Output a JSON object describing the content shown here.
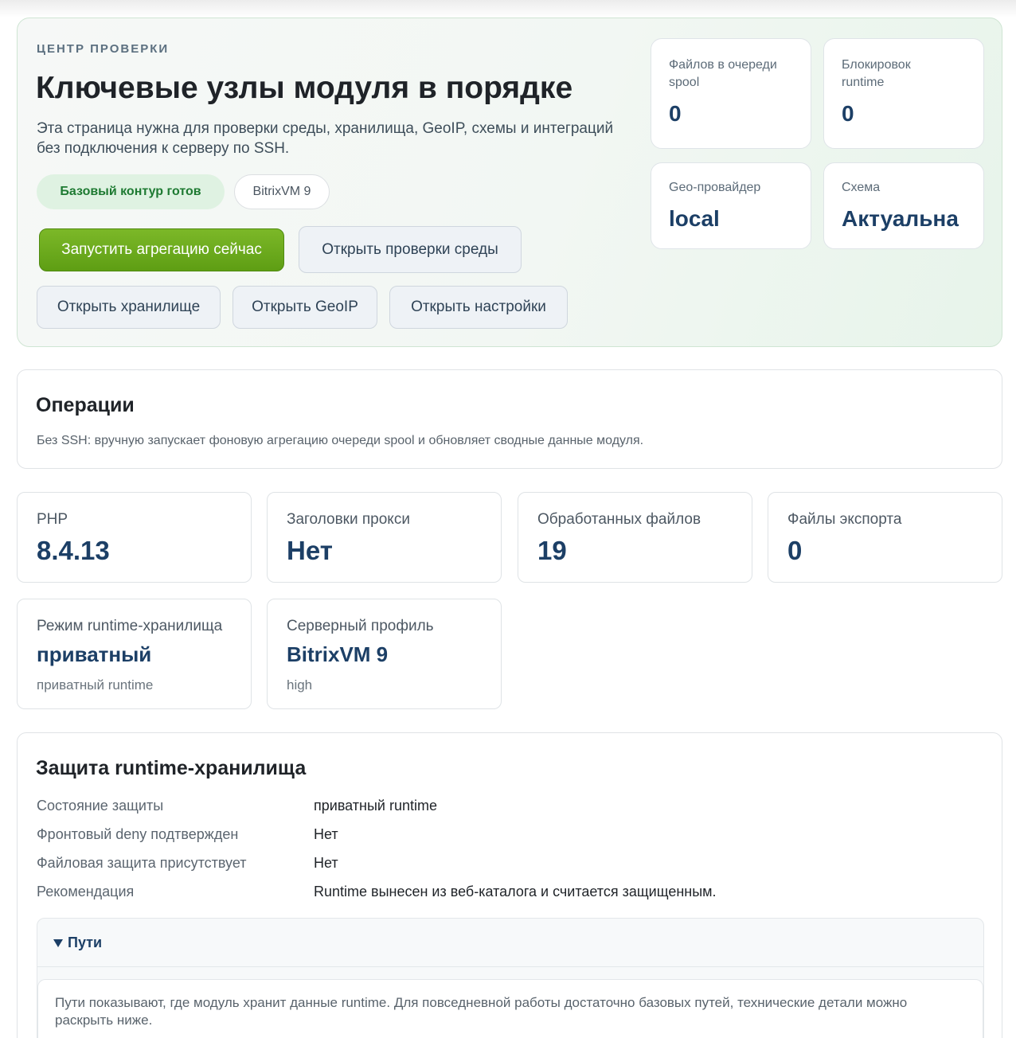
{
  "hero": {
    "eyebrow": "ЦЕНТР ПРОВЕРКИ",
    "title": "Ключевые узлы модуля в порядке",
    "description": "Эта страница нужна для проверки среды, хранилища, GeoIP, схемы и интеграций без подключения к серверу по SSH.",
    "status_pill": "Базовый контур готов",
    "profile_pill": "BitrixVM 9",
    "buttons": {
      "run_aggregation": "Запустить агрегацию сейчас",
      "open_env_checks": "Открыть проверки среды",
      "open_storage": "Открыть хранилище",
      "open_geoip": "Открыть GeoIP",
      "open_settings": "Открыть настройки"
    },
    "stats": [
      {
        "label": "Файлов в очереди spool",
        "value": "0"
      },
      {
        "label": "Блокировок runtime",
        "value": "0"
      },
      {
        "label": "Geo-провайдер",
        "value": "local"
      },
      {
        "label": "Схема",
        "value": "Актуальна"
      }
    ]
  },
  "operations": {
    "title": "Операции",
    "description": "Без SSH: вручную запускает фоновую агрегацию очереди spool и обновляет сводные данные модуля."
  },
  "metrics": [
    {
      "label": "PHP",
      "value": "8.4.13"
    },
    {
      "label": "Заголовки прокси",
      "value": "Нет"
    },
    {
      "label": "Обработанных файлов",
      "value": "19"
    },
    {
      "label": "Файлы экспорта",
      "value": "0"
    },
    {
      "label": "Режим runtime-хранилища",
      "value": "приватный",
      "sub": "приватный runtime"
    },
    {
      "label": "Серверный профиль",
      "value": "BitrixVM 9",
      "sub": "high"
    }
  ],
  "protection": {
    "title": "Защита runtime-хранилища",
    "rows": [
      {
        "key": "Состояние защиты",
        "value": "приватный runtime"
      },
      {
        "key": "Фронтовый deny подтвержден",
        "value": "Нет"
      },
      {
        "key": "Файловая защита присутствует",
        "value": "Нет"
      },
      {
        "key": "Рекомендация",
        "value": "Runtime вынесен из веб-каталога и считается защищенным."
      }
    ],
    "paths": {
      "summary": "Пути",
      "description": "Пути показывают, где модуль хранит данные runtime. Для повседневной работы достаточно базовых путей, технические детали можно раскрыть ниже."
    }
  }
}
